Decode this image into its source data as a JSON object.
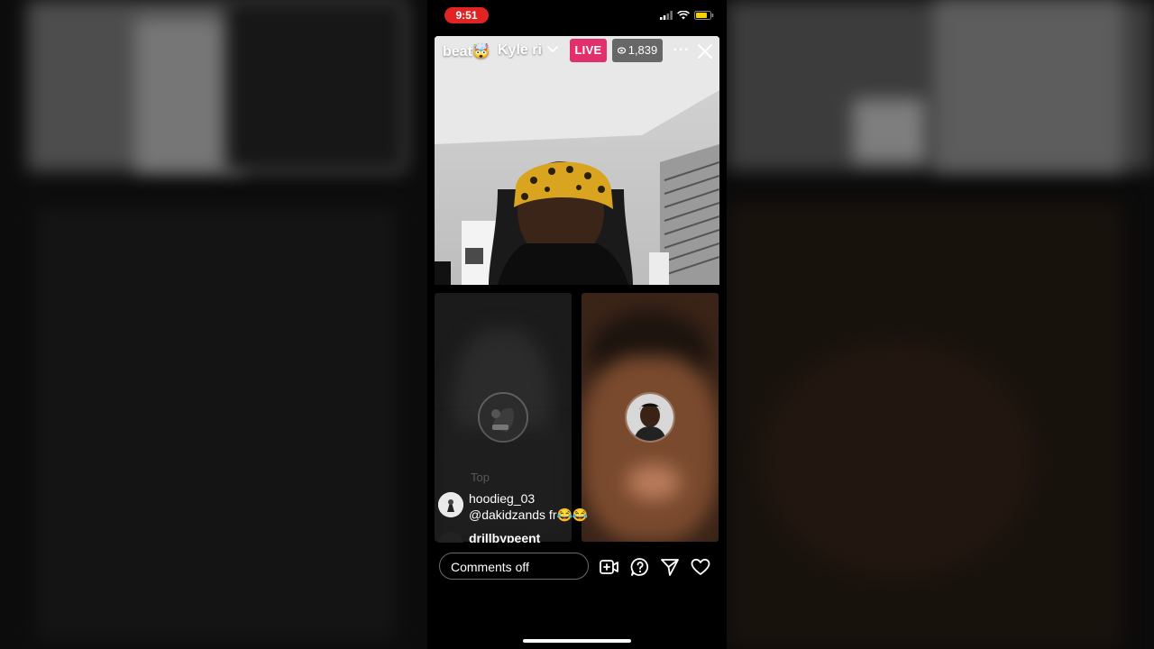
{
  "status_bar": {
    "time": "9:51",
    "icons": [
      "signal-icon",
      "wifi-icon",
      "battery-icon"
    ]
  },
  "live_header": {
    "host_name": "beat🤯",
    "guest_name": "Kyle ric",
    "live_label": "LIVE",
    "viewer_count": "1,839",
    "more_label": "···"
  },
  "comments": {
    "faded_text": "Top",
    "items": [
      {
        "user": "hoodieg_03",
        "text": "@dakidzands fr😂😂"
      },
      {
        "user": "drillbypeent",
        "text": ""
      }
    ]
  },
  "bottom_bar": {
    "comment_placeholder": "Comments off",
    "icons": [
      "add-video-icon",
      "question-icon",
      "send-icon",
      "heart-icon"
    ]
  },
  "colors": {
    "live_badge": "#e1306c",
    "time_pill": "#e02424",
    "battery": "#f5d000"
  }
}
